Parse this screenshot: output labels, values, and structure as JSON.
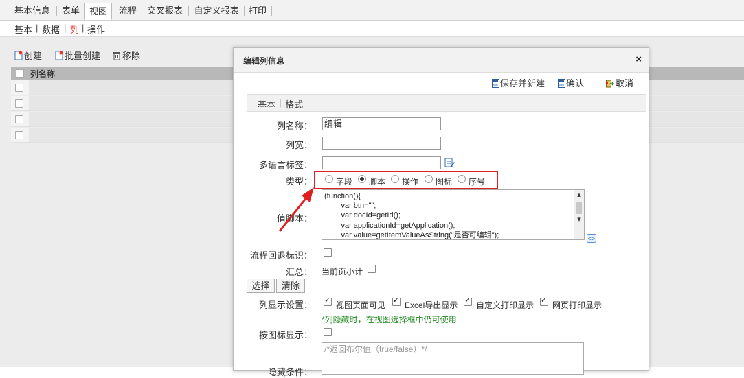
{
  "top_tabs": [
    "基本信息",
    "表单",
    "视图",
    "流程",
    "交叉报表",
    "自定义报表",
    "打印"
  ],
  "sub_nav": {
    "items": [
      "基本",
      "数据",
      "列",
      "操作"
    ],
    "active": "列"
  },
  "toolbar": {
    "create": "创建",
    "batch_create": "批量创建",
    "remove": "移除"
  },
  "grid": {
    "header": "列名称"
  },
  "modal": {
    "title": "编辑列信息",
    "close": "×",
    "buttons": {
      "save_new": "保存并新建",
      "confirm": "确认",
      "cancel": "取消"
    },
    "form_tabs": [
      "基本",
      "格式"
    ],
    "fields": {
      "name_label": "列名称：",
      "name_value": "编辑",
      "width_label": "列宽：",
      "i18n_label": "多语言标签：",
      "type_label": "类型：",
      "type_options": [
        "字段",
        "脚本",
        "操作",
        "图标",
        "序号"
      ],
      "type_selected": "脚本",
      "script_label": "值脚本：",
      "script_lines": [
        "(function(){",
        "        var btn=\"\";",
        "        var docId=getId();",
        "        var applicationId=getApplication();",
        "        var value=getItemValueAsString(\"是否可编辑\");"
      ],
      "rollback_label": "流程回退标识：",
      "summary_label": "汇总：",
      "summary_option": "当前页小计",
      "select_btn": "选择",
      "clear_btn": "清除",
      "display_label": "列显示设置：",
      "display_options": [
        "视图页面可见",
        "Excel导出显示",
        "自定义打印显示",
        "网页打印显示"
      ],
      "display_hint": "*列隐藏时，在视图选择框中仍可使用",
      "icon_display_label": "按图标显示：",
      "hide_condition_placeholder": "/*返回布尔值（true/false）*/",
      "hide_condition_label": "隐藏条件："
    }
  },
  "colors": {
    "highlight_box": "#e02020",
    "arrow": "#e02020",
    "hint": "#1f8a1f",
    "active_subnav": "#e33333"
  }
}
